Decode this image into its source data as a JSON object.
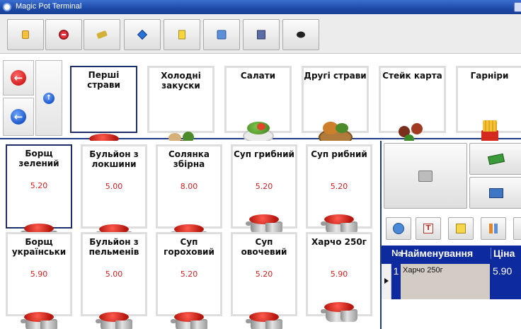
{
  "window": {
    "title": "Magic Pot Terminal"
  },
  "toolbar": {
    "buttons": [
      {
        "icon": "lock-icon"
      },
      {
        "icon": "stop-icon"
      },
      {
        "icon": "key-icon"
      },
      {
        "icon": "diamond-icon"
      },
      {
        "icon": "document-icon"
      },
      {
        "icon": "save-icon"
      },
      {
        "icon": "computer-icon"
      },
      {
        "icon": "pan-icon"
      }
    ]
  },
  "categories": [
    {
      "label": "Перші страви",
      "icon": "pot-icon",
      "selected": true
    },
    {
      "label": "Холодні закуски",
      "icon": "cold-snacks-icon"
    },
    {
      "label": "Салати",
      "icon": "salad-icon"
    },
    {
      "label": "Другі страви",
      "icon": "main-course-icon"
    },
    {
      "label": "Стейк карта",
      "icon": "steak-icon"
    },
    {
      "label": "Гарніри",
      "icon": "fries-icon"
    }
  ],
  "dishes": [
    {
      "name": "Борщ зелений",
      "price": "5.20",
      "selected": true
    },
    {
      "name": "Бульйон з локшини",
      "price": "5.00"
    },
    {
      "name": "Солянка збірна",
      "price": "8.00"
    },
    {
      "name": "Суп грибний",
      "price": "5.20"
    },
    {
      "name": "Суп рибний",
      "price": "5.20"
    },
    {
      "name": "Борщ українськи",
      "price": "5.90"
    },
    {
      "name": "Бульйон з пельменів",
      "price": "5.00"
    },
    {
      "name": "Суп гороховий",
      "price": "5.20"
    },
    {
      "name": "Суп овочевий",
      "price": "5.20"
    },
    {
      "name": "Харчо 250г",
      "price": "5.90"
    }
  ],
  "order": {
    "headers": {
      "no": "№",
      "name": "Найменування",
      "price": "Ціна"
    },
    "rows": [
      {
        "no": "1",
        "name": "Харчо 250г",
        "price": "5.90"
      }
    ]
  },
  "colors": {
    "accent": "#0d2a9e",
    "price": "#d21f1f",
    "selected_border": "#1e2e66"
  }
}
